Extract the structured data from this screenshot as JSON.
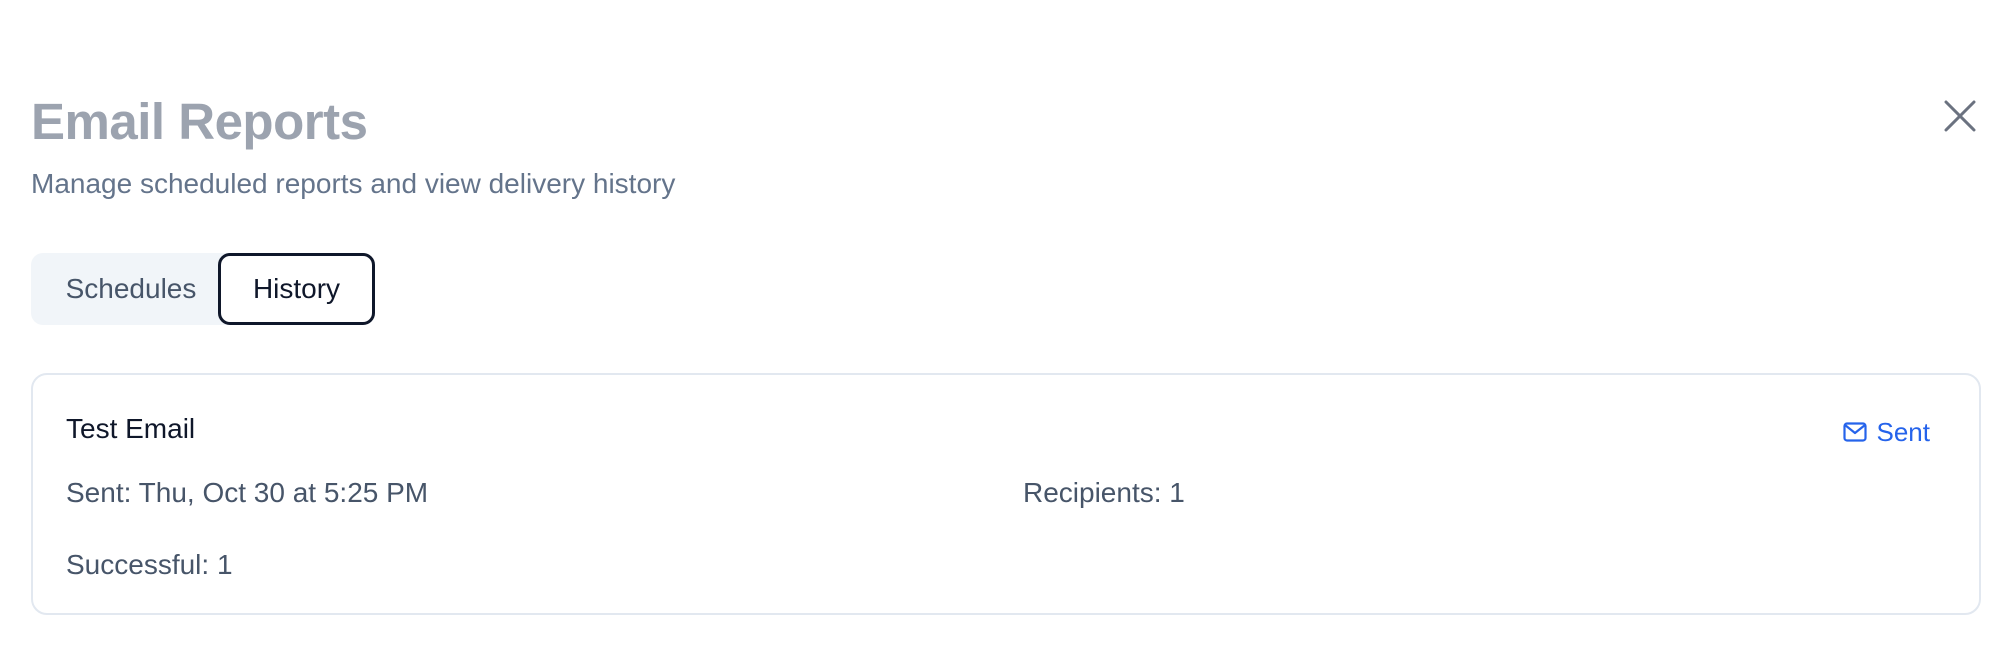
{
  "dialog": {
    "title": "Email Reports",
    "subtitle": "Manage scheduled reports and view delivery history",
    "close_icon": "close-icon"
  },
  "tabs": [
    {
      "label": "Schedules",
      "active": false
    },
    {
      "label": "History",
      "active": true
    }
  ],
  "history": [
    {
      "title": "Test Email",
      "status": "Sent",
      "status_icon": "mail-icon",
      "sent": "Sent: Thu, Oct 30 at 5:25 PM",
      "recipients": "Recipients: 1",
      "successful": "Successful: 1"
    }
  ],
  "colors": {
    "title": "#9ca3af",
    "subtitle": "#64748b",
    "status": "#2563eb",
    "tab_bg": "#f1f5f9",
    "active_tab_border": "#0f172a",
    "card_border": "#e2e8f0"
  }
}
